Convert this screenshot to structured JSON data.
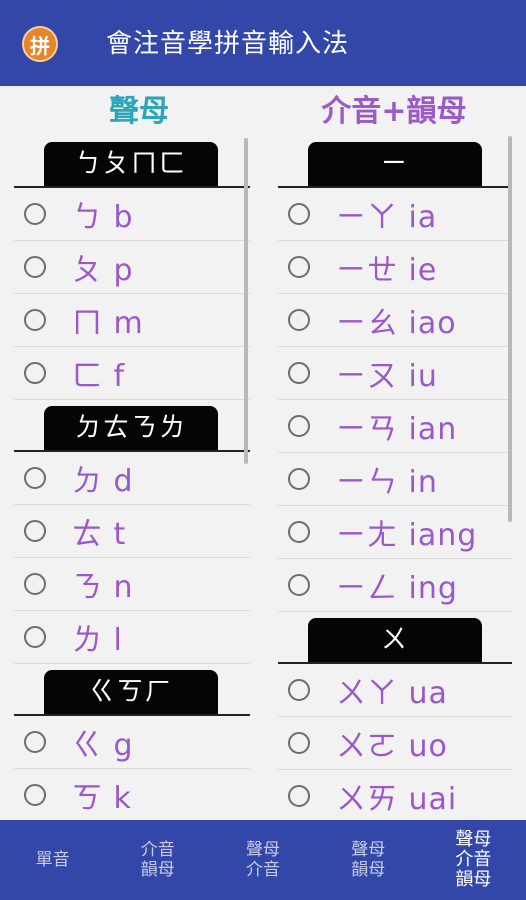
{
  "app": {
    "icon_glyph": "拼",
    "title": "會注音學拼音輸入法"
  },
  "left": {
    "header": "聲母",
    "groups": [
      {
        "title": "ㄅㄆㄇㄈ",
        "items": [
          "ㄅ b",
          "ㄆ p",
          "ㄇ m",
          "ㄈ f"
        ]
      },
      {
        "title": "ㄉㄊㄋㄌ",
        "items": [
          "ㄉ d",
          "ㄊ t",
          "ㄋ n",
          "ㄌ l"
        ]
      },
      {
        "title": "ㄍㄎㄏ",
        "items": [
          "ㄍ g",
          "ㄎ k"
        ]
      }
    ]
  },
  "right": {
    "header": "介音+韻母",
    "groups": [
      {
        "title": "ㄧ",
        "items": [
          "ㄧㄚ ia",
          "ㄧㄝ ie",
          "ㄧㄠ iao",
          "ㄧㄡ iu",
          "ㄧㄢ ian",
          "ㄧㄣ in",
          "ㄧㄤ iang",
          "ㄧㄥ ing"
        ]
      },
      {
        "title": "ㄨ",
        "items": [
          "ㄨㄚ ua",
          "ㄨㄛ uo",
          "ㄨㄞ uai"
        ]
      }
    ]
  },
  "nav": {
    "items": [
      "單音",
      "介音\n韻母",
      "聲母\n介音",
      "聲母\n韻母",
      "聲母\n介音\n韻母"
    ],
    "active_index": 4
  },
  "colors": {
    "primary": "#3347a9",
    "accent_teal": "#2aa6b8",
    "accent_purple": "#9a58c8"
  }
}
